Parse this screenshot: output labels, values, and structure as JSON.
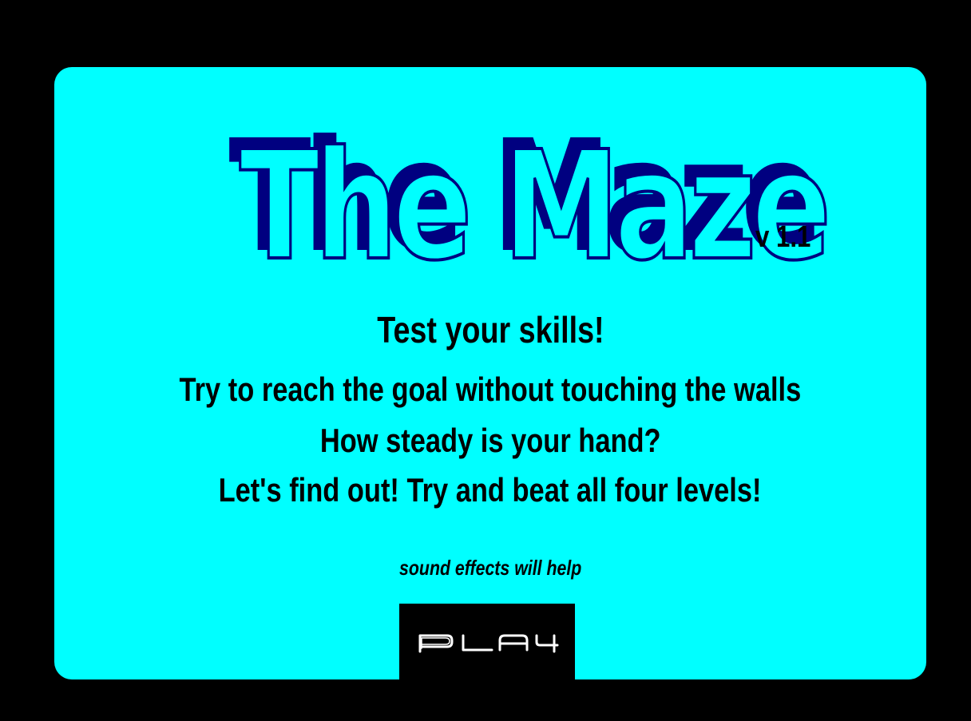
{
  "game": {
    "title": "The Maze",
    "version": "v 1.1",
    "headline": "Test your skills!",
    "description": [
      "Try to reach the goal without touching the walls",
      "How steady is your hand?",
      "Let's find out! Try and beat all four levels!"
    ],
    "hint": "sound effects will help",
    "play_button": {
      "label": "PLAY",
      "icon": "play-logo-glyphs"
    }
  },
  "colors": {
    "background": "#000000",
    "panel": "#00ffff",
    "title_outline": "#000080",
    "text": "#000000",
    "button_background": "#000000",
    "button_text": "#ffffff"
  }
}
